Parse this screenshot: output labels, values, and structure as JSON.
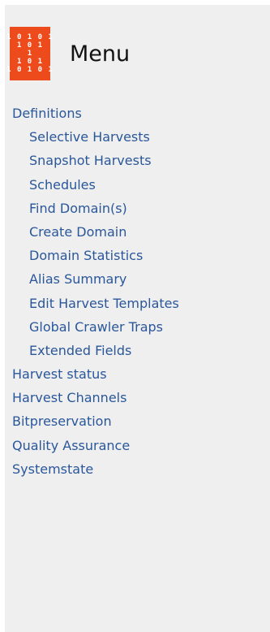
{
  "header": {
    "title": "Menu",
    "logo": {
      "icon": "binary-logo-icon",
      "color": "#ee4b1c",
      "lines": [
        "1 0 1 0 1",
        "1 0 1",
        "1",
        "1 0 1",
        "1 0 1 0 1"
      ]
    }
  },
  "menu": {
    "link_color": "#2a579a",
    "items": [
      {
        "label": "Definitions",
        "level": 0
      },
      {
        "label": "Selective Harvests",
        "level": 1
      },
      {
        "label": "Snapshot Harvests",
        "level": 1
      },
      {
        "label": "Schedules",
        "level": 1
      },
      {
        "label": "Find Domain(s)",
        "level": 1
      },
      {
        "label": "Create Domain",
        "level": 1
      },
      {
        "label": "Domain Statistics",
        "level": 1
      },
      {
        "label": "Alias Summary",
        "level": 1
      },
      {
        "label": "Edit Harvest Templates",
        "level": 1
      },
      {
        "label": "Global Crawler Traps",
        "level": 1
      },
      {
        "label": "Extended Fields",
        "level": 1
      },
      {
        "label": "Harvest status",
        "level": 0
      },
      {
        "label": "Harvest Channels",
        "level": 0
      },
      {
        "label": "Bitpreservation",
        "level": 0
      },
      {
        "label": "Quality Assurance",
        "level": 0
      },
      {
        "label": "Systemstate",
        "level": 0
      }
    ]
  }
}
